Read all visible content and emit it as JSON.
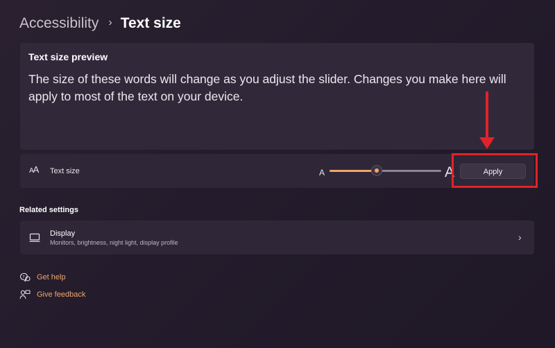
{
  "breadcrumb": {
    "parent": "Accessibility",
    "separator": "›",
    "current": "Text size"
  },
  "preview": {
    "title": "Text size preview",
    "text": "The size of these words will change as you adjust the slider. Changes you make here will apply to most of the text on your device."
  },
  "text_size": {
    "label": "Text size",
    "icon": "text-size-icon",
    "slider_min_label": "A",
    "slider_max_label": "A",
    "slider_level": 0.42,
    "apply_label": "Apply"
  },
  "related": {
    "heading": "Related settings",
    "display": {
      "title": "Display",
      "subtitle": "Monitors, brightness, night light, display profile",
      "icon": "monitor-icon"
    }
  },
  "links": {
    "help": "Get help",
    "feedback": "Give feedback"
  },
  "colors": {
    "accent": "#f2a66a",
    "annotation": "#e0232a",
    "link": "#f0a66b"
  }
}
